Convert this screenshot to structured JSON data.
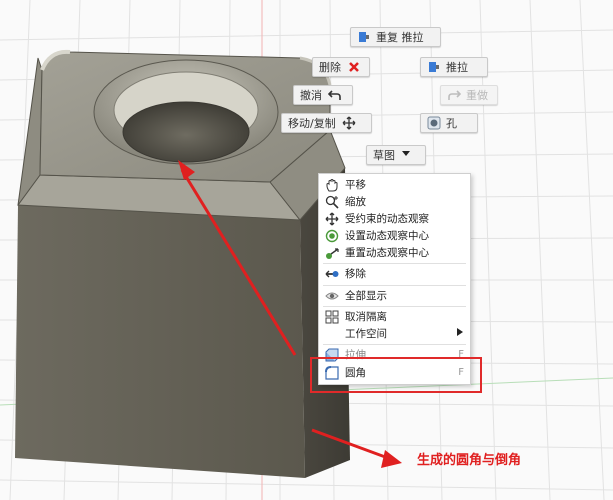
{
  "marking_menu": {
    "repeat_extrude": "重复 推拉",
    "delete": "删除",
    "extrude": "推拉",
    "undo": "撤消",
    "redo": "重做",
    "move_copy": "移动/复制",
    "hole": "孔",
    "sketch": "草图"
  },
  "context_menu": {
    "items": [
      {
        "label": "平移",
        "icon": "hand-pan-icon"
      },
      {
        "label": "缩放",
        "icon": "zoom-icon"
      },
      {
        "label": "受约束的动态观察",
        "icon": "orbit-icon"
      },
      {
        "label": "设置动态观察中心",
        "icon": "target-icon"
      },
      {
        "label": "重置动态观察中心",
        "icon": "reset-center-icon"
      },
      {
        "label": "移除",
        "icon": "remove-icon"
      },
      {
        "label": "全部显示",
        "icon": "eye-icon"
      },
      {
        "label": "取消隔离",
        "icon": "grid-icon"
      },
      {
        "label": "工作空间",
        "icon": "submenu-arrow-icon"
      },
      {
        "label": "拉伸",
        "shortcut": "F",
        "icon": "extrude-icon"
      },
      {
        "label": "圆角",
        "shortcut": "F",
        "icon": "fillet-icon"
      }
    ]
  },
  "annotation": {
    "caption": "生成的圆角与倒角",
    "color": "#e02020"
  },
  "colors": {
    "highlight": "#e02a2a",
    "model_side": "#5d5a4f",
    "model_top": "#9a988c",
    "grid": "#dedede"
  }
}
